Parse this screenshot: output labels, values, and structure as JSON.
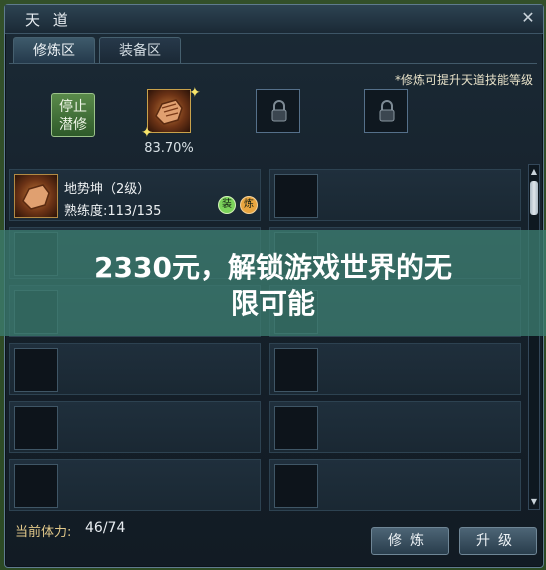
{
  "window": {
    "title": "天 道",
    "close_label": "✕"
  },
  "tabs": [
    {
      "label": "修炼区"
    },
    {
      "label": "装备区"
    }
  ],
  "top": {
    "hint": "*修炼可提升天道技能等级",
    "stop_button": {
      "line1": "停止",
      "line2": "潜修"
    },
    "progress_text": "83.70%"
  },
  "skill": {
    "name": "地势坤（2级）",
    "proficiency": "熟练度:113/135",
    "badge_equip": "装",
    "badge_train": "炼"
  },
  "overlay": {
    "line1": "2330元，解锁游戏世界的无",
    "line2": "限可能"
  },
  "bottom": {
    "stamina_label": "当前体力:",
    "stamina_value": "46/74",
    "train_button": "修炼",
    "upgrade_button": "升级"
  },
  "colors": {
    "window_bg": "#16222c",
    "overlay": "#3c7c70",
    "accent_gold": "#c9a24b"
  }
}
